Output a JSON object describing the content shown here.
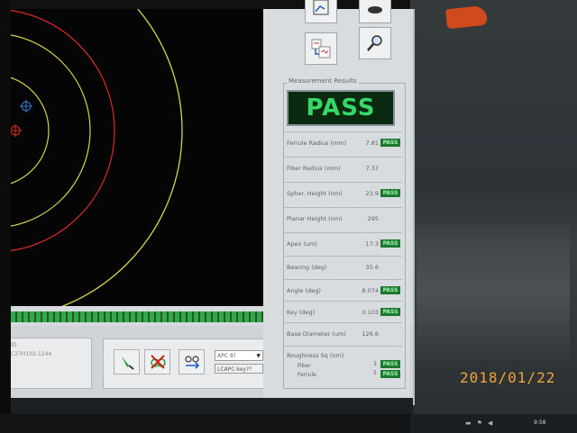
{
  "measurement_results": {
    "group_label": "Measurement Results",
    "overall": "PASS",
    "rows": [
      {
        "label": "Ferrule Radius (mm)",
        "value": "7.81",
        "status": "PASS"
      },
      {
        "label": "Fiber Radius (mm)",
        "value": "7.37",
        "status": ""
      },
      {
        "label": "Spher. Height (nm)",
        "value": "23.9",
        "status": "PASS"
      },
      {
        "label": "Planar Height (nm)",
        "value": "295",
        "status": ""
      },
      {
        "label": "Apex (um)",
        "value": "17.3",
        "status": "PASS"
      },
      {
        "label": "Bearing (deg)",
        "value": "35.6",
        "status": ""
      },
      {
        "label": "Angle (deg)",
        "value": "8.074",
        "status": "PASS"
      },
      {
        "label": "Key (deg)",
        "value": "0.103",
        "status": "PASS"
      },
      {
        "label": "Base Diameter (um)",
        "value": "126.6",
        "status": ""
      }
    ],
    "roughness": {
      "label": "Roughness Sq (nm)",
      "fiber_label": "Fiber",
      "fiber_value": "3",
      "fiber_status": "PASS",
      "ferrule_label": "Ferrule",
      "ferrule_value": "5",
      "ferrule_status": "PASS"
    }
  },
  "bottom": {
    "info_line_1": "ID",
    "info_line_2": "C27H102-1244",
    "apc_select": "APC 8?",
    "lcapc_button": "LCAPC-key??"
  },
  "progress": {
    "fraction": 1.0
  },
  "taskbar": {
    "time": "9:58"
  },
  "photo_date_stamp": "2018/01/22",
  "colors": {
    "pass_green": "#37d868",
    "badge_green": "#1c7a30",
    "accent_orange": "#f2a23a"
  },
  "icons": {
    "top_buttons": [
      "plot-icon",
      "camera-icon",
      "analysis-icon",
      "magnifier-icon"
    ],
    "tools": [
      "probe-icon",
      "disable-icon",
      "transfer-icon"
    ]
  }
}
